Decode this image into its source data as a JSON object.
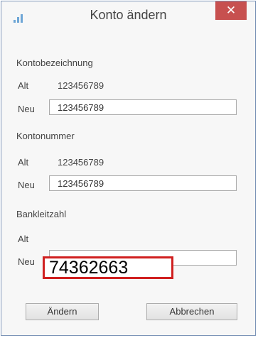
{
  "window": {
    "title": "Konto ändern",
    "close_glyph": "✕",
    "icon": "bar-chart-icon"
  },
  "sections": [
    {
      "title": "Kontobezeichnung",
      "old_label": "Alt",
      "old_value": "123456789",
      "new_label": "Neu",
      "new_value": "123456789"
    },
    {
      "title": "Kontonummer",
      "old_label": "Alt",
      "old_value": "123456789",
      "new_label": "Neu",
      "new_value": "123456789"
    },
    {
      "title": "Bankleitzahl",
      "old_label": "Alt",
      "old_value": "",
      "new_label": "Neu",
      "new_value": ""
    }
  ],
  "highlight": {
    "text": "74362663",
    "color": "#d02020"
  },
  "buttons": {
    "apply": "Ändern",
    "cancel": "Abbrechen"
  },
  "colors": {
    "close_button": "#c7504f",
    "icon": "#6ea6d6"
  }
}
